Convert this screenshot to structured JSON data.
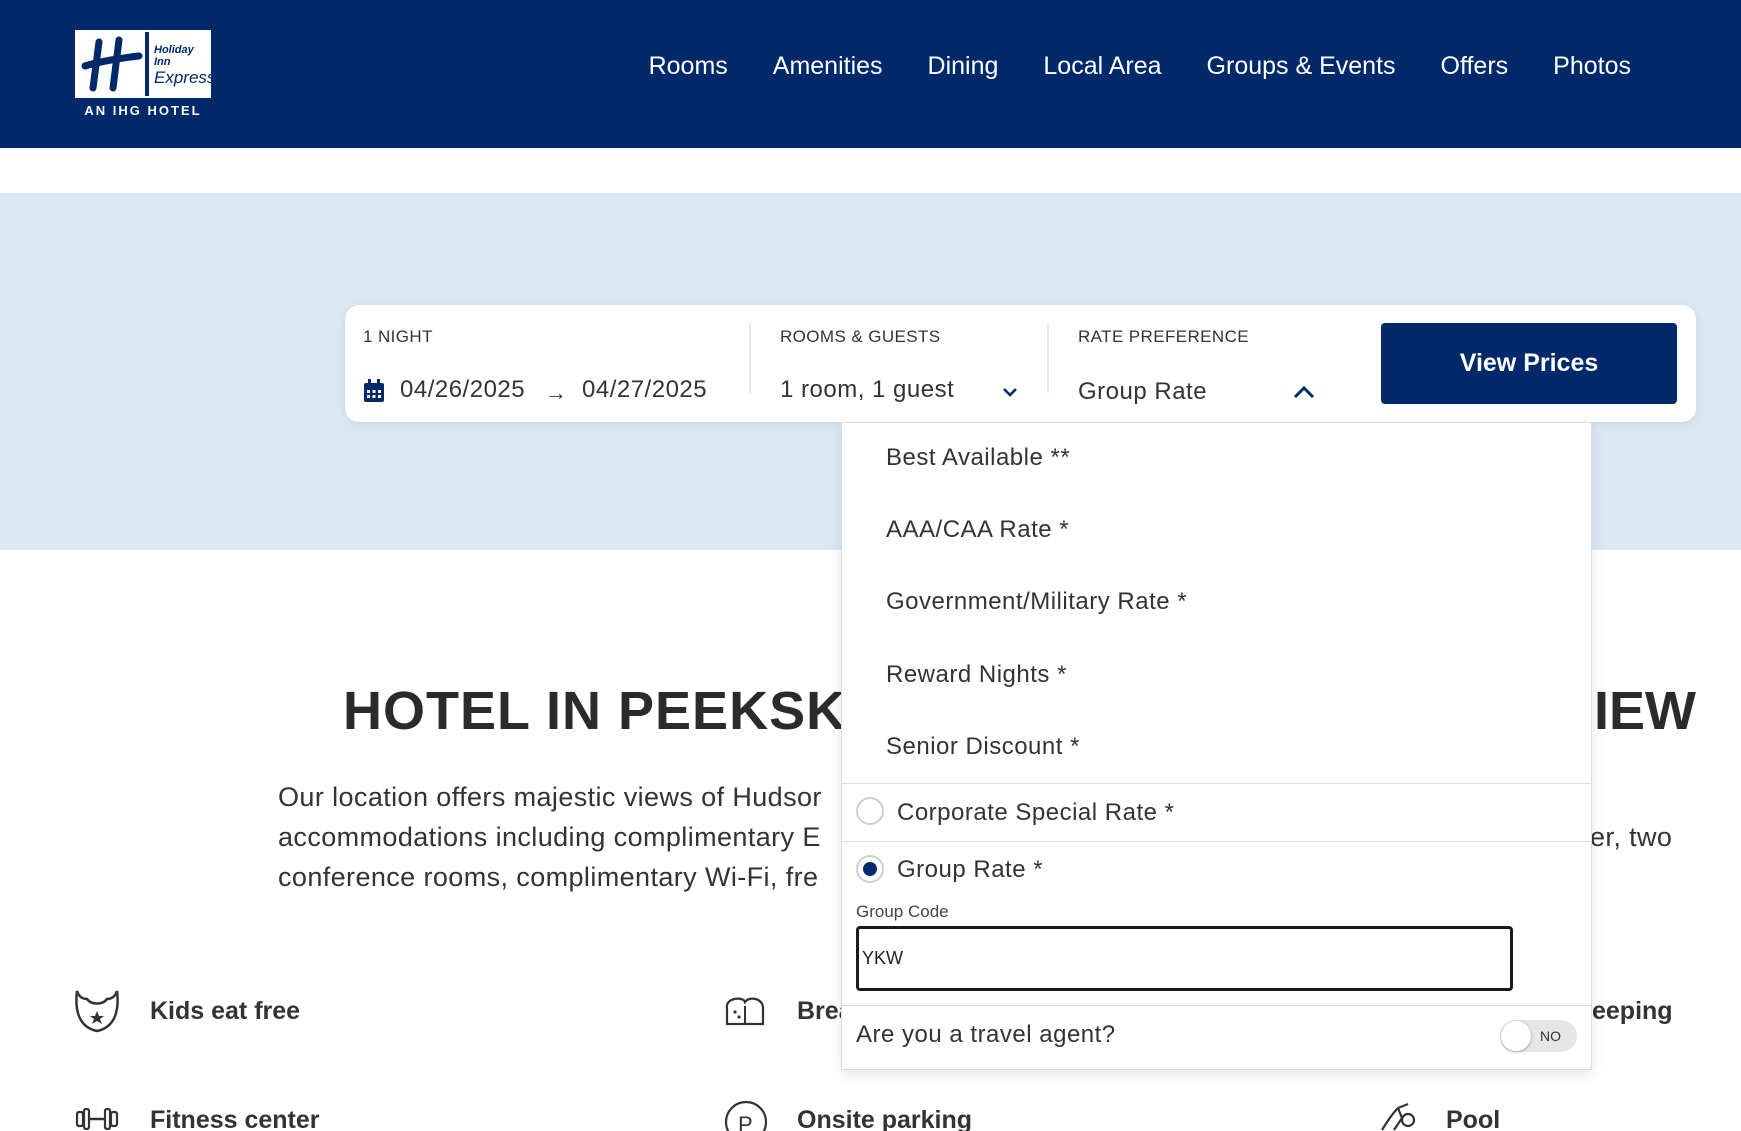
{
  "header": {
    "logo": {
      "line1": "Holiday Inn",
      "line2": "Express",
      "tagline": "AN IHG HOTEL"
    },
    "nav": [
      "Rooms",
      "Amenities",
      "Dining",
      "Local Area",
      "Groups & Events",
      "Offers",
      "Photos"
    ]
  },
  "booking": {
    "nights_label": "1 NIGHT",
    "checkin": "04/26/2025",
    "checkout": "04/27/2025",
    "arrow": "→",
    "rooms_label": "ROOMS & GUESTS",
    "rooms_value": "1 room, 1 guest",
    "rate_label": "RATE PREFERENCE",
    "rate_value": "Group Rate",
    "view_prices": "View Prices"
  },
  "rate_dropdown": {
    "options": [
      "Best Available **",
      "AAA/CAA Rate *",
      "Government/Military Rate *",
      "Reward Nights *",
      "Senior Discount *"
    ],
    "radio_options": [
      {
        "label": "Corporate Special Rate *",
        "selected": false
      },
      {
        "label": "Group Rate *",
        "selected": true
      }
    ],
    "group_code_label": "Group Code",
    "group_code_value": "YKW",
    "travel_agent_question": "Are you a travel agent?",
    "travel_agent_toggle": "NO"
  },
  "content": {
    "title_left": "HOTEL IN PEEKSKIL",
    "title_right": "IEW",
    "para_lines": [
      "Our location offers majestic views of Hudsor",
      "accommodations including complimentary E",
      "conference rooms, complimentary Wi-Fi, fre"
    ],
    "para_right": "er, two",
    "amenities": [
      "Kids eat free",
      "Brea",
      "eeping",
      "Fitness center",
      "Onsite parking",
      "Pool"
    ]
  },
  "colors": {
    "brand_navy": "#00296b",
    "hero_bg": "#d9e8f3"
  }
}
